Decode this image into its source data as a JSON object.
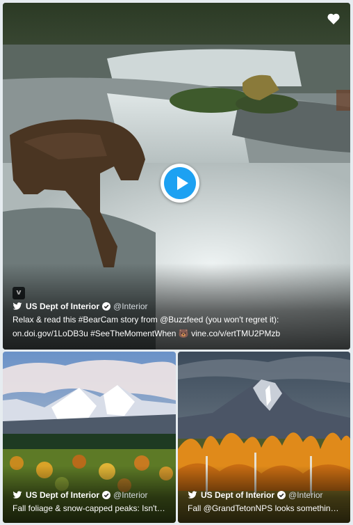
{
  "colors": {
    "accent": "#1da1f2",
    "background": "#e6ecf0"
  },
  "main_tweet": {
    "author_name": "US Dept of Interior",
    "author_handle": "@Interior",
    "text_line1": "Relax & read this #BearCam story from @Buzzfeed (you won't regret it):",
    "text_line2": "on.doi.gov/1LoDB3u #SeeTheMomentWhen 🐻 vine.co/v/ertTMU2PMzb",
    "media_type": "video",
    "icons": [
      "heart-icon",
      "play-icon",
      "vine-icon",
      "twitter-bird-icon",
      "verified-icon"
    ]
  },
  "left_tweet": {
    "author_name": "US Dept of Interior",
    "author_handle": "@Interior",
    "text": "Fall foliage & snow-capped peaks: Isn't…"
  },
  "right_tweet": {
    "author_name": "US Dept of Interior",
    "author_handle": "@Interior",
    "text": "Fall @GrandTetonNPS looks somethin…"
  }
}
